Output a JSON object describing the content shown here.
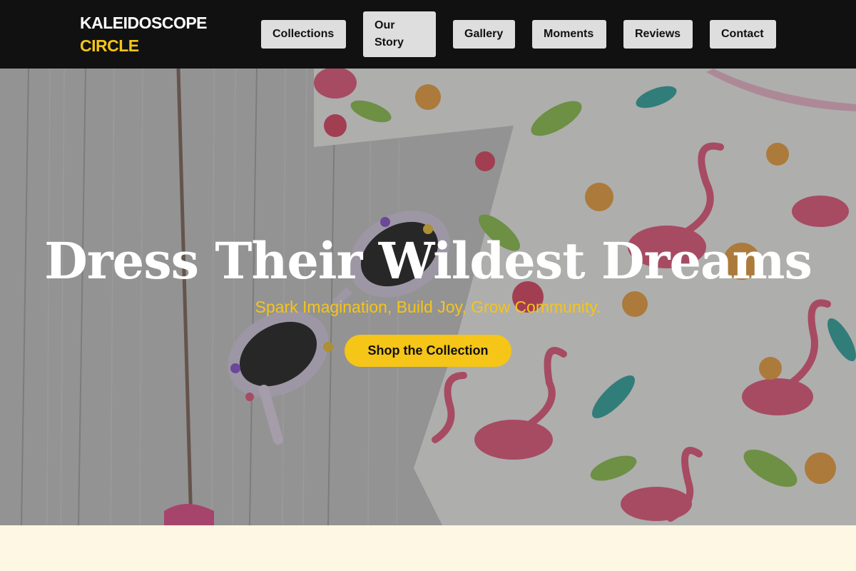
{
  "brand": {
    "line1": "KALEIDOSCOPE",
    "line2": "CIRCLE"
  },
  "nav": {
    "collections": "Collections",
    "our_story_1": "Our",
    "our_story_2": "Story",
    "gallery": "Gallery",
    "moments": "Moments",
    "reviews": "Reviews",
    "contact": "Contact"
  },
  "hero": {
    "title": "Dress Their Wildest Dreams",
    "subtitle": "Spark Imagination, Build Joy, Grow Community.",
    "cta": "Shop the Collection"
  },
  "colors": {
    "accent": "#f5c518",
    "header_bg": "#111111",
    "nav_bg": "#dedede",
    "cream": "#fdf7e3"
  }
}
